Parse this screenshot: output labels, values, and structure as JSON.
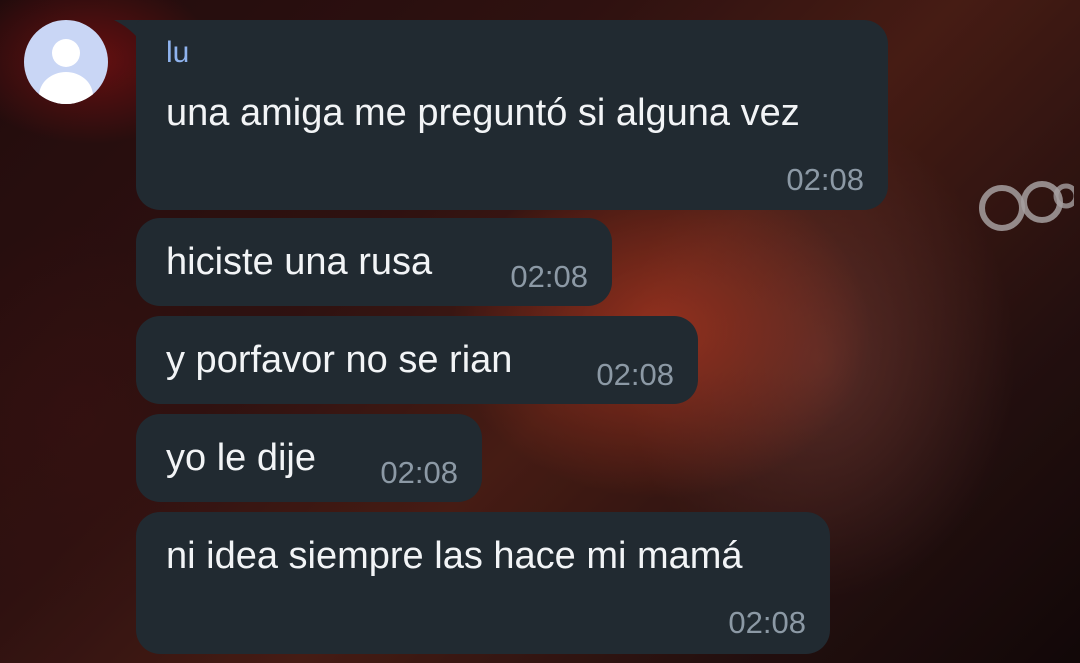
{
  "chat": {
    "sender_name": "lu",
    "avatar_icon": "default-user-icon",
    "bubble_color": "#212a31",
    "sender_name_color": "#8fb3ee",
    "messages": [
      {
        "text": "una amiga me preguntó si alguna vez",
        "time": "02:08"
      },
      {
        "text": "hiciste una rusa",
        "time": "02:08"
      },
      {
        "text": "y porfavor no se rian",
        "time": "02:08"
      },
      {
        "text": "yo le dije",
        "time": "02:08"
      },
      {
        "text": "ni idea siempre las hace mi mamá",
        "time": "02:08"
      }
    ]
  }
}
